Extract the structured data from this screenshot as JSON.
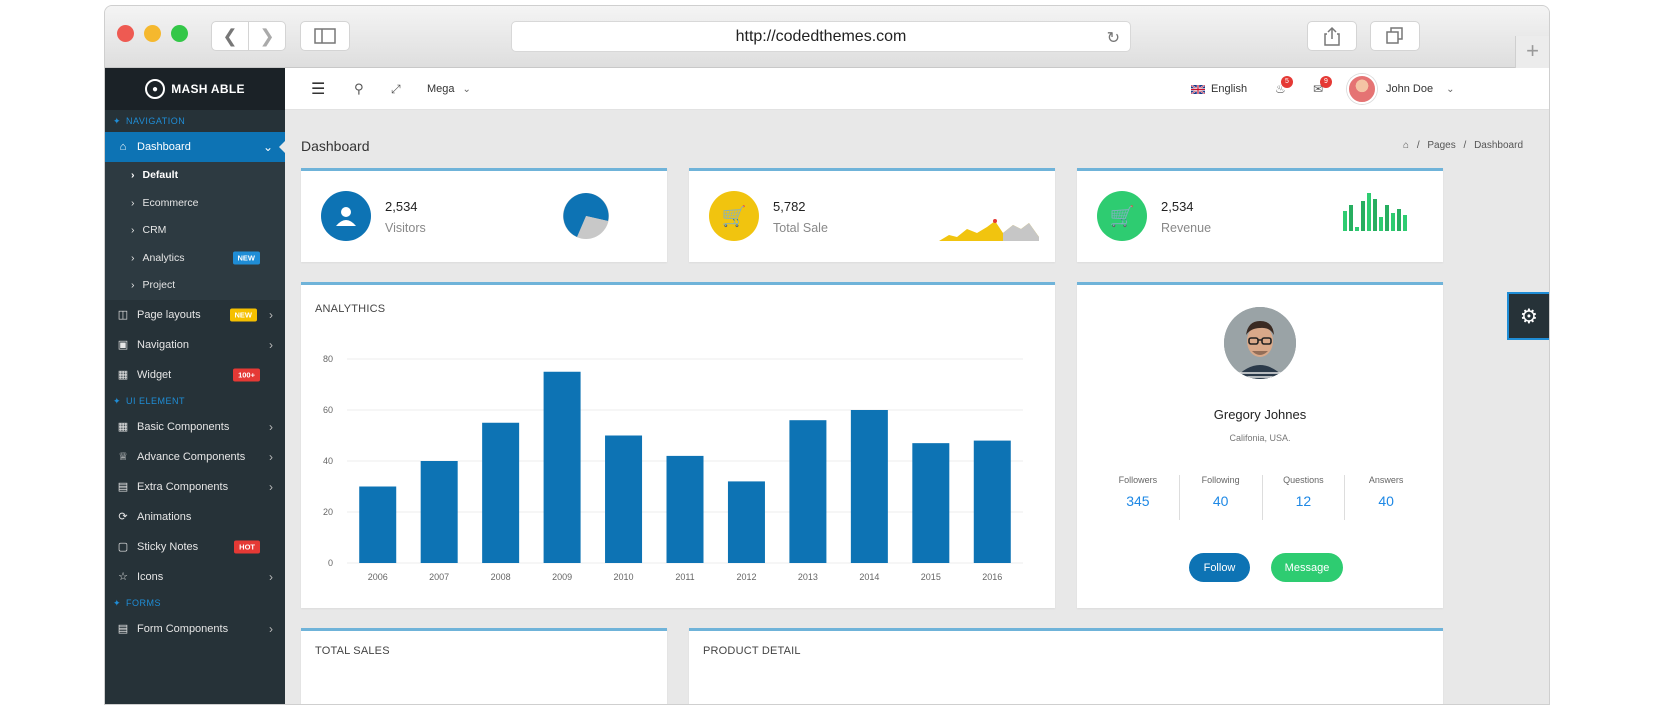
{
  "browser": {
    "url": "http://codedthemes.com",
    "plus_icon": "+",
    "back_icon": "chevron-left-icon",
    "forward_icon": "chevron-right-icon"
  },
  "brand": {
    "name": "MASH ABLE"
  },
  "sidebar": {
    "cap_navigation": "NAVIGATION",
    "cap_ui": "UI ELEMENT",
    "cap_forms": "FORMS",
    "dashboard": "Dashboard",
    "subs": [
      {
        "label": "Default"
      },
      {
        "label": "Ecommerce"
      },
      {
        "label": "CRM"
      },
      {
        "label": "Analytics",
        "badge": "NEW"
      },
      {
        "label": "Project"
      }
    ],
    "items": [
      {
        "label": "Page layouts",
        "badge": "NEW"
      },
      {
        "label": "Navigation"
      },
      {
        "label": "Widget",
        "badge": "100+"
      }
    ],
    "ui_items": [
      {
        "label": "Basic Components"
      },
      {
        "label": "Advance Components"
      },
      {
        "label": "Extra Components"
      },
      {
        "label": "Animations"
      },
      {
        "label": "Sticky Notes",
        "badge": "HOT"
      },
      {
        "label": "Icons"
      }
    ],
    "form_items": [
      {
        "label": "Form Components"
      }
    ]
  },
  "topbar": {
    "mega": "Mega",
    "language": "English",
    "notif_count": "5",
    "msg_count": "9",
    "user": "John Doe"
  },
  "page": {
    "title": "Dashboard",
    "crumb_pages": "Pages",
    "crumb_current": "Dashboard",
    "sep": "/"
  },
  "stats": [
    {
      "value": "2,534",
      "label": "Visitors",
      "color": "#0d73b4"
    },
    {
      "value": "5,782",
      "label": "Total Sale",
      "color": "#f1c40f"
    },
    {
      "value": "2,534",
      "label": "Revenue",
      "color": "#2ecc71"
    }
  ],
  "analytics": {
    "title": "ANALYTHICS"
  },
  "chart_data": {
    "type": "bar",
    "categories": [
      "2006",
      "2007",
      "2008",
      "2009",
      "2010",
      "2011",
      "2012",
      "2013",
      "2014",
      "2015",
      "2016"
    ],
    "values": [
      30,
      40,
      55,
      75,
      50,
      42,
      32,
      56,
      60,
      47,
      48
    ],
    "yticks": [
      "0",
      "20",
      "40",
      "60",
      "80"
    ],
    "ylim": [
      0,
      80
    ],
    "color": "#0d73b4",
    "grid": true
  },
  "profile": {
    "name": "Gregory Johnes",
    "location": "Califonia, USA.",
    "stats": [
      {
        "label": "Followers",
        "value": "345"
      },
      {
        "label": "Following",
        "value": "40"
      },
      {
        "label": "Questions",
        "value": "12"
      },
      {
        "label": "Answers",
        "value": "40"
      }
    ],
    "follow": "Follow",
    "message": "Message"
  },
  "bottom": {
    "total_sales": "TOTAL SALES",
    "product_detail": "PRODUCT DETAIL"
  }
}
